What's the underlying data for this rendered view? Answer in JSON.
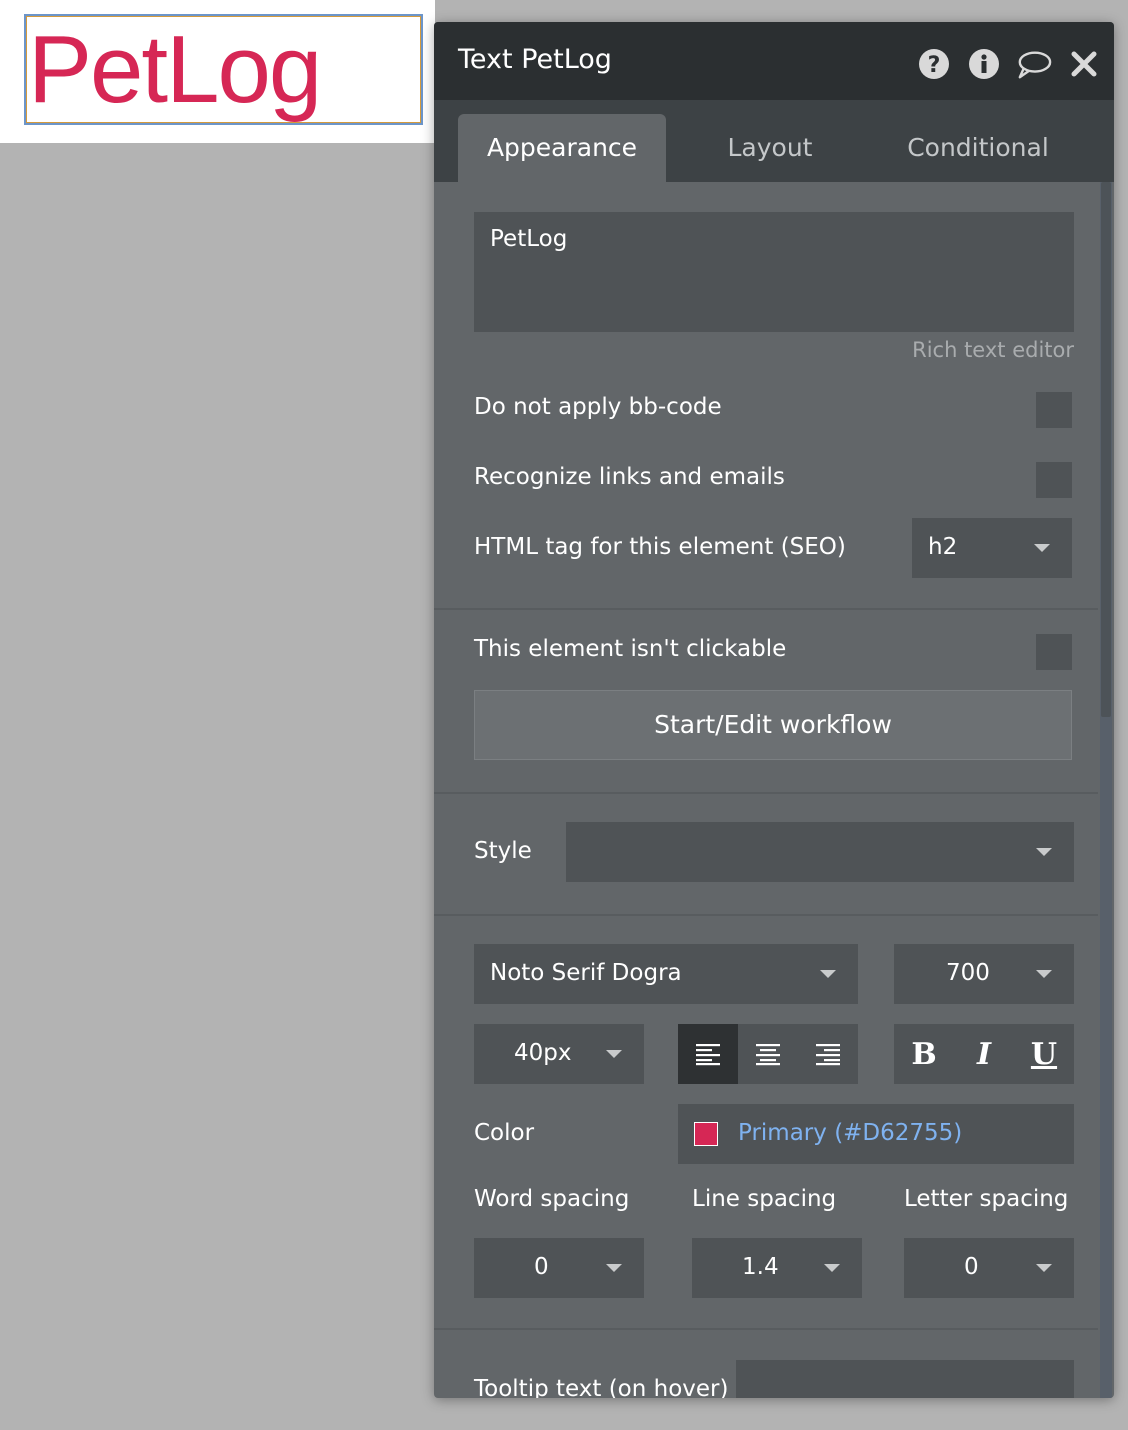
{
  "canvas": {
    "element_text": "PetLog",
    "text_color": "#D62755"
  },
  "panel": {
    "title": "Text PetLog",
    "header_icons": [
      "help-icon",
      "info-icon",
      "comment-icon",
      "close-icon"
    ],
    "tabs": [
      {
        "label": "Appearance",
        "active": true
      },
      {
        "label": "Layout",
        "active": false
      },
      {
        "label": "Conditional",
        "active": false
      }
    ],
    "content_text": "PetLog",
    "rich_text_editor_link": "Rich text editor",
    "do_not_apply_bbcode": {
      "label": "Do not apply bb-code",
      "checked": false
    },
    "recognize_links": {
      "label": "Recognize links and emails",
      "checked": false
    },
    "html_tag": {
      "label": "HTML tag for this element (SEO)",
      "value": "h2"
    },
    "not_clickable": {
      "label": "This element isn't clickable",
      "checked": false
    },
    "workflow_button": "Start/Edit workflow",
    "style": {
      "label": "Style",
      "value": ""
    },
    "font": {
      "family": "Noto Serif Dogra",
      "weight": "700",
      "size": "40px",
      "alignment": "left",
      "bold_label": "B",
      "italic_label": "I",
      "underline_label": "U"
    },
    "color": {
      "label": "Color",
      "value": "Primary (#D62755)",
      "swatch": "#D62755"
    },
    "spacing": {
      "word_label": "Word spacing",
      "word_value": "0",
      "line_label": "Line spacing",
      "line_value": "1.4",
      "letter_label": "Letter spacing",
      "letter_value": "0"
    },
    "tooltip": {
      "label": "Tooltip text (on hover)",
      "value": ""
    }
  }
}
